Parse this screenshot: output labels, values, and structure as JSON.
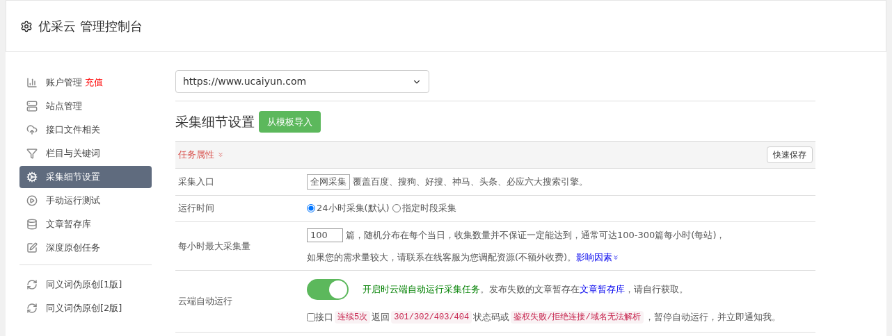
{
  "header": {
    "title": "优采云 管理控制台"
  },
  "sidebar": {
    "groups": [
      {
        "items": [
          {
            "label": "账户管理",
            "badge": "充值",
            "selected": false
          },
          {
            "label": "站点管理",
            "selected": false
          },
          {
            "label": "接口文件相关",
            "selected": false
          },
          {
            "label": "栏目与关键词",
            "selected": false
          },
          {
            "label": "采集细节设置",
            "selected": true
          },
          {
            "label": "手动运行测试",
            "selected": false
          },
          {
            "label": "文章暂存库",
            "selected": false
          },
          {
            "label": "深度原创任务",
            "selected": false
          }
        ]
      },
      {
        "items": [
          {
            "label": "同义词伪原创[1版]",
            "selected": false
          },
          {
            "label": "同义词伪原创[2版]",
            "selected": false
          }
        ]
      }
    ]
  },
  "site_select": {
    "value": "https://www.ucaiyun.com"
  },
  "section": {
    "title": "采集细节设置",
    "import_button": "从模板导入"
  },
  "panel": {
    "heading": "任务属性",
    "save_button": "快速保存",
    "rows": [
      {
        "kind": "source",
        "label": "采集入口",
        "option": "全网采集",
        "text": "覆盖百度、搜狗、好搜、神马、头条、必应六大搜索引擎。"
      },
      {
        "kind": "radios",
        "label": "运行时间",
        "options": [
          {
            "label": "24小时采集(默认)",
            "selected": true
          },
          {
            "label": "指定时段采集",
            "selected": false
          }
        ]
      },
      {
        "kind": "amount",
        "label": "每小时最大采集量",
        "value": "100",
        "line1": "篇，随机分布在每个当日，收集数量并不保证一定能达到，通常可达100-300篇每小时(每站)，",
        "line2": "如果您的需求量较大，请联系在线客服为您调配资源(不额外收费)。",
        "link": "影响因素"
      },
      {
        "kind": "cloud",
        "label": "云端自动运行",
        "on": true,
        "green_text": "开启时云端自动运行采集任务",
        "text": "。发布失败的文章暂存在",
        "link": "文章暂存库",
        "tail": "，请自行获取。",
        "notify": {
          "checked": false,
          "parts": [
            {
              "kind": "text",
              "text": "接口"
            },
            {
              "kind": "code",
              "text": "连续5次"
            },
            {
              "kind": "text",
              "text": "返回"
            },
            {
              "kind": "code",
              "text": "301/302/403/404"
            },
            {
              "kind": "text",
              "text": "状态码或"
            },
            {
              "kind": "code",
              "text": "鉴权失败/拒绝连接/域名无法解析"
            },
            {
              "kind": "text",
              "text": "，暂停自动运行，并立即通知我。"
            }
          ]
        }
      }
    ]
  }
}
